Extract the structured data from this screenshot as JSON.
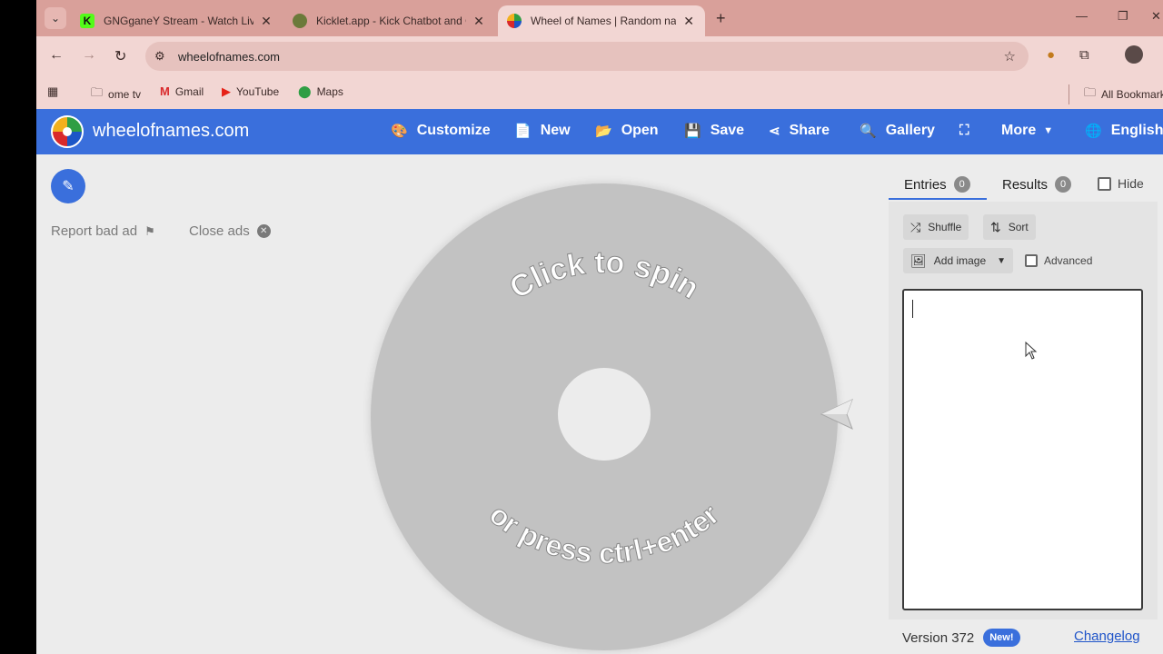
{
  "browser": {
    "tabs": [
      {
        "title": "GNGganeY Stream - Watch Live",
        "favicon_color": "#53fc18"
      },
      {
        "title": "Kicklet.app - Kick Chatbot and Overlays",
        "favicon_color": "#6b7a3a"
      },
      {
        "title": "Wheel of Names | Random name picker",
        "favicon_color": "#d9292b"
      }
    ],
    "url": "wheelofnames.com",
    "bookmarks": [
      "ome tv",
      "Gmail",
      "YouTube",
      "Maps"
    ],
    "all_bookmarks": "All Bookmarks"
  },
  "app": {
    "brand": "wheelofnames.com",
    "menu": {
      "customize": "Customize",
      "new": "New",
      "open": "Open",
      "save": "Save",
      "share": "Share",
      "gallery": "Gallery",
      "more": "More",
      "language": "English"
    },
    "ads": {
      "report": "Report bad ad",
      "close": "Close ads"
    },
    "wheel": {
      "top_text": "Click to spin",
      "bottom_text": "or press ctrl+enter"
    },
    "panel": {
      "entries_label": "Entries",
      "entries_count": "0",
      "results_label": "Results",
      "results_count": "0",
      "hide_label": "Hide",
      "shuffle": "Shuffle",
      "sort": "Sort",
      "add_image": "Add image",
      "advanced": "Advanced",
      "entries_value": ""
    },
    "footer": {
      "version": "Version 372",
      "new_badge": "New!",
      "changelog": "Changelog"
    }
  },
  "colors": {
    "accent": "#3a6fdc",
    "browser_frame": "#d9a09a",
    "wheel_gray": "#c2c2c2"
  }
}
